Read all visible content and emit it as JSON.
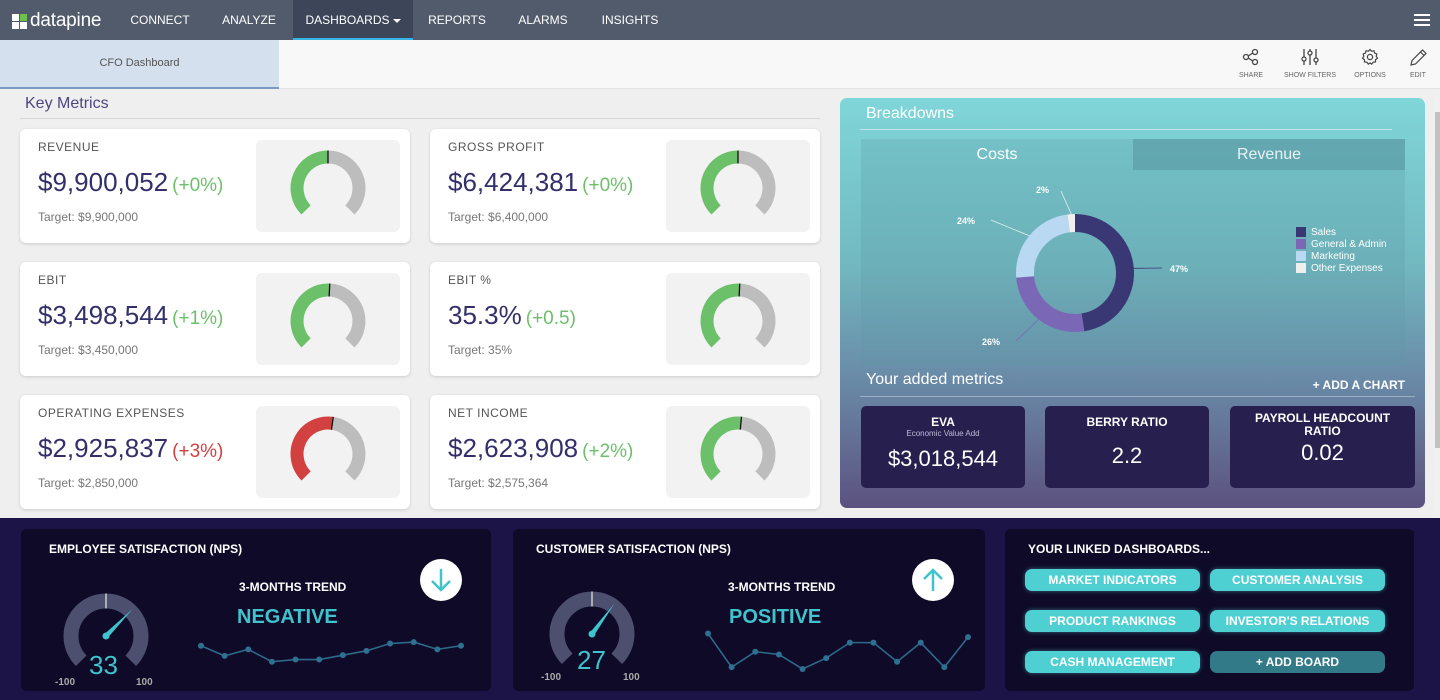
{
  "app": {
    "brand": "datapine"
  },
  "nav": {
    "items": [
      {
        "label": "CONNECT"
      },
      {
        "label": "ANALYZE"
      },
      {
        "label": "DASHBOARDS",
        "active": true
      },
      {
        "label": "REPORTS"
      },
      {
        "label": "ALARMS"
      },
      {
        "label": "INSIGHTS"
      }
    ],
    "menu_icon": "hamburger-icon"
  },
  "tabbar": {
    "dashboard_tab": "CFO Dashboard",
    "tools": [
      {
        "label": "SHARE",
        "icon": "share-icon"
      },
      {
        "label": "SHOW FILTERS",
        "icon": "filters-icon"
      },
      {
        "label": "OPTIONS",
        "icon": "gear-icon"
      },
      {
        "label": "EDIT",
        "icon": "pencil-icon"
      }
    ]
  },
  "key_metrics": {
    "title": "Key Metrics",
    "cards": [
      {
        "label": "REVENUE",
        "value": "$9,900,052",
        "delta": "(+0%)",
        "status": "good",
        "target": "Target: $9,900,000",
        "gauge_fraction": 0.5
      },
      {
        "label": "GROSS PROFIT",
        "value": "$6,424,381",
        "delta": "(+0%)",
        "status": "good",
        "target": "Target: $6,400,000",
        "gauge_fraction": 0.5
      },
      {
        "label": "EBIT",
        "value": "$3,498,544",
        "delta": "(+1%)",
        "status": "good",
        "target": "Target: $3,450,000",
        "gauge_fraction": 0.51
      },
      {
        "label": "EBIT %",
        "value": "35.3%",
        "delta": "(+0.5)",
        "status": "good",
        "target": "Target: 35%",
        "gauge_fraction": 0.51
      },
      {
        "label": "OPERATING EXPENSES",
        "value": "$2,925,837",
        "delta": "(+3%)",
        "status": "bad",
        "target": "Target: $2,850,000",
        "gauge_fraction": 0.53
      },
      {
        "label": "NET INCOME",
        "value": "$2,623,908",
        "delta": "(+2%)",
        "status": "good",
        "target": "Target: $2,575,364",
        "gauge_fraction": 0.52
      }
    ]
  },
  "colors": {
    "good": "#6cc06a",
    "bad": "#d34040",
    "gauge_rest": "#bdbdbd",
    "value_text": "#322f6b",
    "accent_teal": "#3fc3cc"
  },
  "breakdowns": {
    "title": "Breakdowns",
    "tabs": [
      {
        "label": "Costs",
        "active": true
      },
      {
        "label": "Revenue",
        "active": false
      }
    ],
    "chart_data": {
      "type": "pie",
      "variant": "donut",
      "categories": [
        "Sales",
        "General & Admin",
        "Marketing",
        "Other Expenses"
      ],
      "values": [
        47,
        26,
        24,
        2
      ],
      "labels": [
        "47%",
        "26%",
        "24%",
        "2%"
      ],
      "colors": [
        "#3a3775",
        "#7a68b6",
        "#b9d8f2",
        "#efefef"
      ],
      "legend": "top-right"
    }
  },
  "added_metrics": {
    "title": "Your added metrics",
    "add_label": "+  ADD A CHART",
    "cards": [
      {
        "title": "EVA",
        "subtitle": "Economic Value Add",
        "value": "$3,018,544"
      },
      {
        "title": "BERRY RATIO",
        "subtitle": "",
        "value": "2.2"
      },
      {
        "title": "PAYROLL HEADCOUNT RATIO",
        "subtitle": "",
        "value": "0.02"
      }
    ]
  },
  "nps": [
    {
      "title": "EMPLOYEE SATISFACTION (NPS)",
      "value": "33",
      "min": "-100",
      "max": "100",
      "numeric": 33,
      "trend_label": "3-MONTHS TREND",
      "trend": "NEGATIVE",
      "arrow": "arrow-down-icon",
      "sparkline": [
        52,
        38,
        47,
        30,
        33,
        33,
        39,
        45,
        55,
        57,
        47,
        52
      ]
    },
    {
      "title": "CUSTOMER SATISFACTION (NPS)",
      "value": "27",
      "min": "-100",
      "max": "100",
      "numeric": 27,
      "trend_label": "3-MONTHS TREND",
      "trend": "POSITIVE",
      "arrow": "arrow-up-icon",
      "sparkline": [
        70,
        33,
        50,
        47,
        31,
        43,
        60,
        60,
        39,
        60,
        33,
        66
      ]
    }
  ],
  "linked": {
    "title": "YOUR LINKED DASHBOARDS...",
    "buttons": [
      {
        "label": "MARKET INDICATORS"
      },
      {
        "label": "CUSTOMER ANALYSIS"
      },
      {
        "label": "PRODUCT RANKINGS"
      },
      {
        "label": "INVESTOR'S RELATIONS"
      },
      {
        "label": "CASH MANAGEMENT"
      },
      {
        "label": "+  ADD BOARD"
      }
    ]
  }
}
